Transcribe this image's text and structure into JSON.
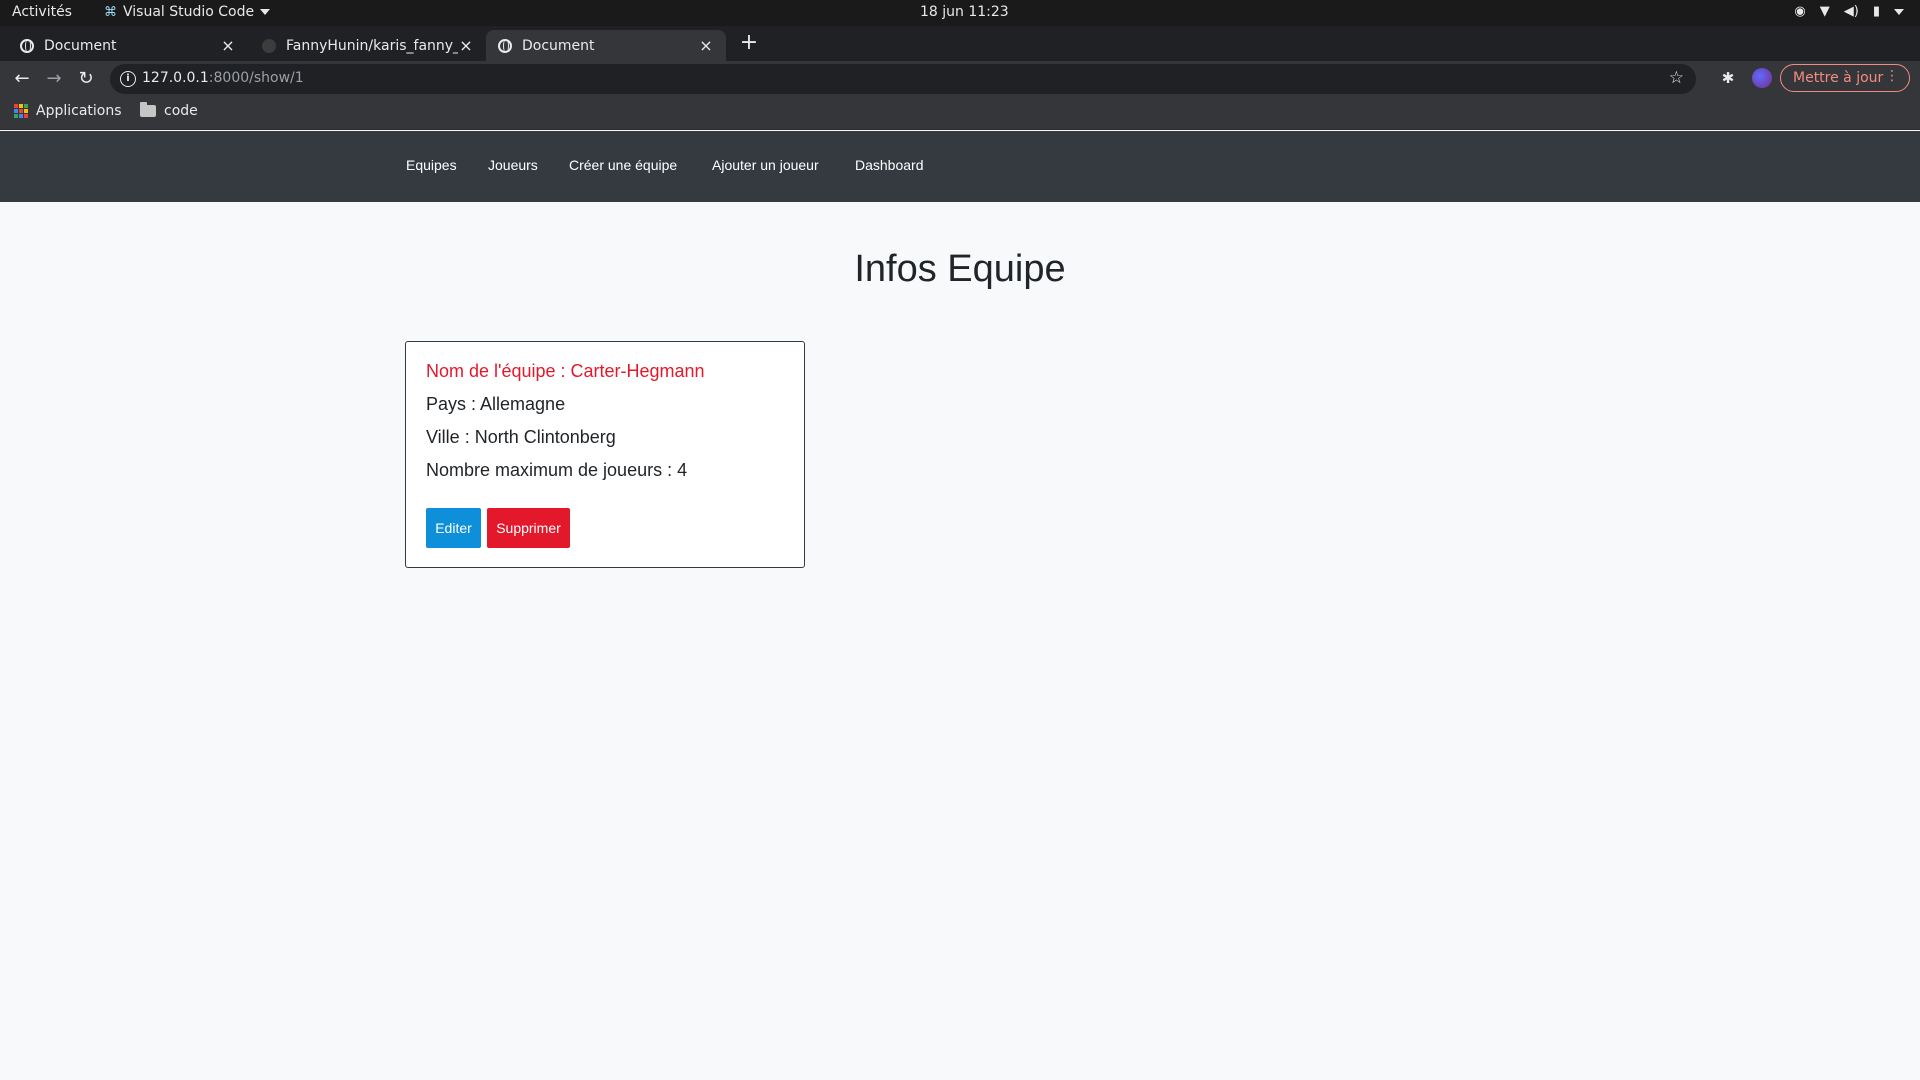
{
  "os_bar": {
    "activities": "Activités",
    "app_name": "Visual Studio Code",
    "clock": "18 jun  11:23"
  },
  "browser": {
    "tabs": [
      {
        "title": "Document",
        "active": false
      },
      {
        "title": "FannyHunin/karis_fanny_",
        "active": false
      },
      {
        "title": "Document",
        "active": true
      }
    ],
    "new_tab": "+",
    "url_host": "127.0.0.1",
    "url_path": ":8000/show/1",
    "update_label": "Mettre à jour",
    "bookmarks": [
      {
        "label": "Applications",
        "icon": "apps-grid-icon"
      },
      {
        "label": "code",
        "icon": "folder-icon"
      }
    ]
  },
  "site_nav": {
    "items": [
      "Equipes",
      "Joueurs",
      "Créer une équipe",
      "Ajouter un joueur",
      "Dashboard"
    ]
  },
  "page": {
    "title": "Infos Equipe",
    "team_line": "Nom de l'équipe : Carter-Hegmann",
    "country_line": "Pays : Allemagne",
    "city_line": "Ville : North Clintonberg",
    "max_players_line": "Nombre maximum de joueurs : 4",
    "edit_label": "Editer",
    "delete_label": "Supprimer"
  },
  "colors": {
    "navbar_bg": "#343a40",
    "danger": "#e3192b",
    "info": "#0d8fd9",
    "page_bg": "#f8f9fa"
  }
}
